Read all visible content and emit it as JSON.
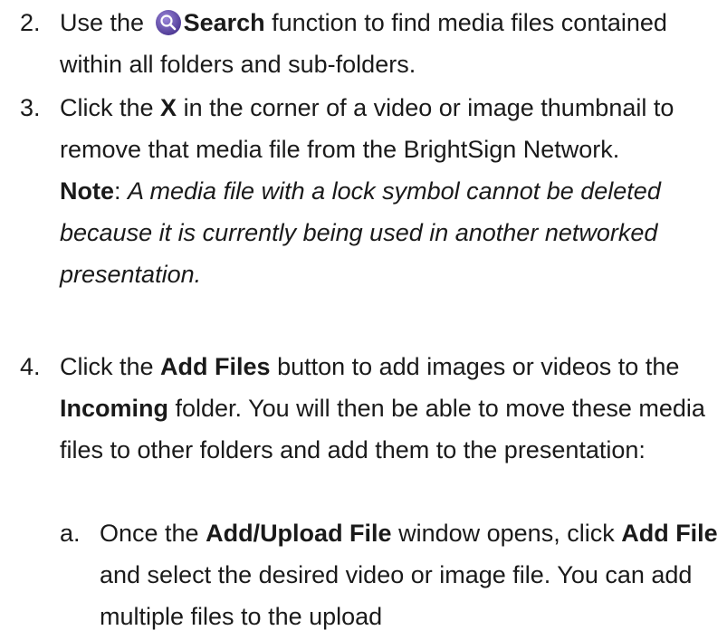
{
  "items": [
    {
      "number": "2.",
      "pre": "Use the ",
      "bold": "Search",
      "post": " function to find media files contained within all folders and sub-folders.",
      "icon": "search-icon"
    },
    {
      "number": "3.",
      "pre": "Click the ",
      "bold": "X",
      "post": " in the corner of a video or image thumbnail to remove that media file from the BrightSign Network.",
      "note_label": "Note",
      "note_colon": ": ",
      "note_text": "A media file with a lock symbol cannot be deleted because it is currently being used in another networked presentation."
    },
    {
      "number": "4.",
      "pre": "Click the ",
      "bold": "Add Files",
      "mid": " button to add images or videos to the ",
      "bold2": "Incoming",
      "post": " folder. You will then be able to move these media files to other folders and add them to the presentation:"
    }
  ],
  "subitems": [
    {
      "letter": "a.",
      "pre": "Once the ",
      "bold": "Add/Upload File",
      "mid": " window opens, click ",
      "bold2": "Add File",
      "post": " and select the desired video or image file. You can add multiple files to the upload"
    }
  ],
  "colors": {
    "icon_bg": "#6a4fb5",
    "text": "#1a1a1a"
  }
}
